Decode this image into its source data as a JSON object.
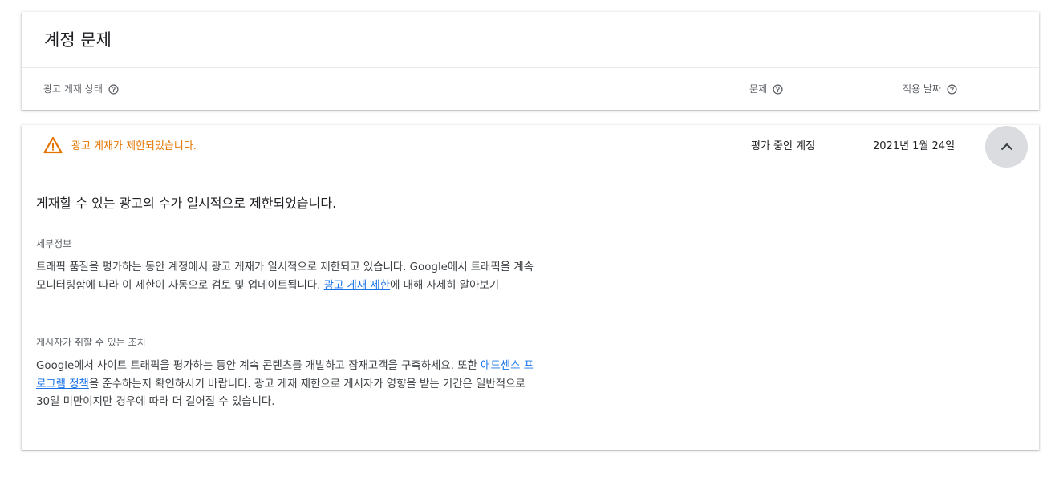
{
  "header": {
    "title": "계정 문제",
    "columns": {
      "ad_serving_status": "광고 게재 상태",
      "issue": "문제",
      "applied_date": "적용 날짜"
    },
    "help_icon": "help-circle-icon"
  },
  "issue": {
    "warning_icon": "warning-triangle-icon",
    "warning_color": "#e37400",
    "summary": "광고 게재가 제한되었습니다.",
    "status": "평가 중인 계정",
    "date": "2021년 1월 24일",
    "collapse_icon": "chevron-up-icon",
    "headline": "게재할 수 있는 광고의 수가 일시적으로 제한되었습니다.",
    "details": {
      "label": "세부정보",
      "text_before_link": "트래픽 품질을 평가하는 동안 계정에서 광고 게재가 일시적으로 제한되고 있습니다. Google에서 트래픽을 계속 모니터링함에 따라 이 제한이 자동으로 검토 및 업데이트됩니다. ",
      "link_text": "광고 게재 제한",
      "text_after_link": "에 대해 자세히 알아보기"
    },
    "actions": {
      "label": "게시자가 취할 수 있는 조치",
      "text_before_link": "Google에서 사이트 트래픽을 평가하는 동안 계속 콘텐츠를 개발하고 잠재고객을 구축하세요. 또한 ",
      "link_text": "애드센스 프로그램 정책",
      "text_after_link": "을 준수하는지 확인하시기 바랍니다. 광고 게재 제한으로 게시자가 영향을 받는 기간은 일반적으로 30일 미만이지만 경우에 따라 더 길어질 수 있습니다."
    }
  },
  "colors": {
    "link": "#1a73e8",
    "collapse_button_bg": "#dadce0"
  }
}
